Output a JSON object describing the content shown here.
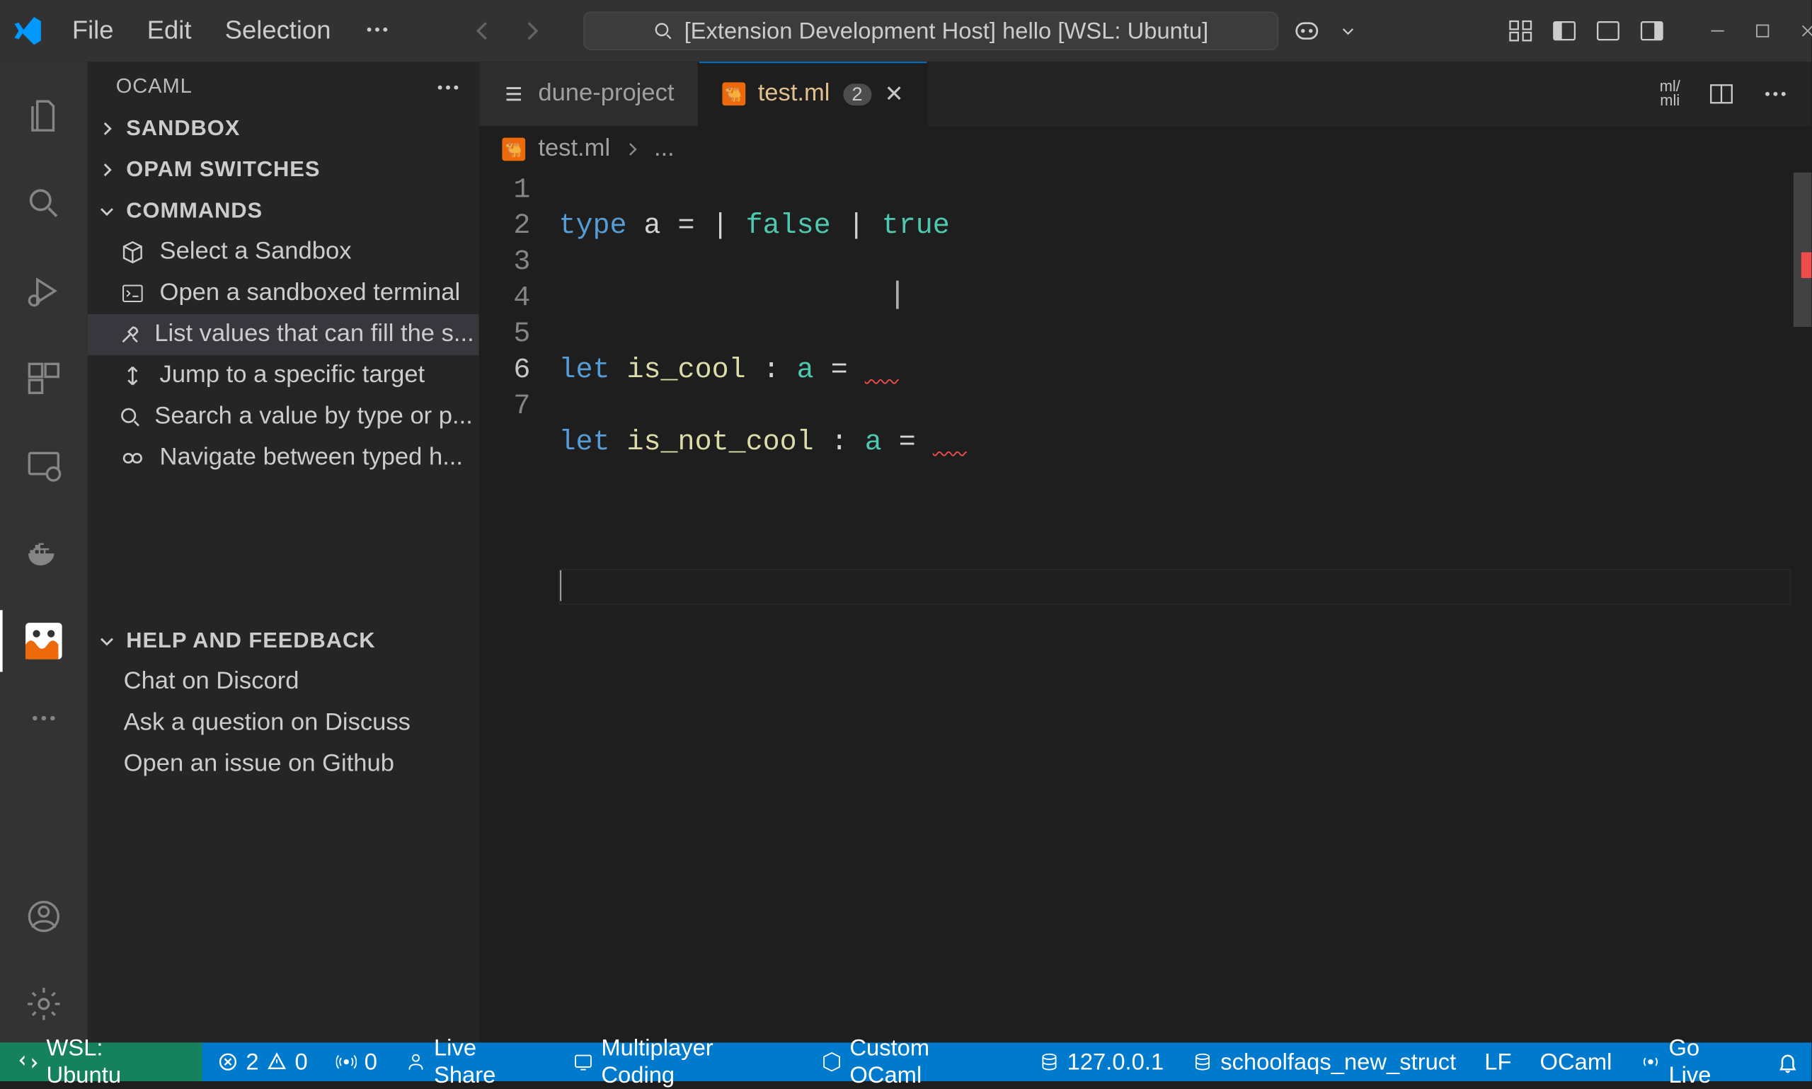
{
  "titlebar": {
    "menu": {
      "file": "File",
      "edit": "Edit",
      "selection": "Selection"
    },
    "search_text": "[Extension Development Host] hello [WSL: Ubuntu]"
  },
  "sidebar": {
    "title": "OCAML",
    "sections": {
      "sandbox": "SANDBOX",
      "opam": "OPAM SWITCHES",
      "commands": "COMMANDS",
      "help": "HELP AND FEEDBACK"
    },
    "commands": [
      "Select a Sandbox",
      "Open a sandboxed terminal",
      "List values that can fill the s...",
      "Jump to a specific target",
      "Search a value by type or p...",
      "Navigate between typed h..."
    ],
    "help_items": [
      "Chat on Discord",
      "Ask a question on Discuss",
      "Open an issue on Github"
    ]
  },
  "tabs": {
    "t1": {
      "label": "dune-project"
    },
    "t2": {
      "label": "test.ml",
      "badge": "2"
    }
  },
  "breadcrumb": {
    "file": "test.ml",
    "rest": "..."
  },
  "code": {
    "lines": [
      "1",
      "2",
      "3",
      "4",
      "5",
      "6",
      "7"
    ],
    "l1": {
      "kw": "type",
      "ident": "a",
      "eq": "=",
      "p1": "|",
      "v1": "false",
      "p2": "|",
      "v2": "true"
    },
    "l3": {
      "kw": "let",
      "name": "is_cool",
      "colon": ":",
      "ty": "a",
      "eq": "="
    },
    "l4": {
      "kw": "let",
      "name": "is_not_cool",
      "colon": ":",
      "ty": "a",
      "eq": "="
    }
  },
  "tabactions": {
    "mlmli": "ml/\nmli"
  },
  "statusbar": {
    "remote": "WSL: Ubuntu",
    "errors": "2",
    "warnings": "0",
    "ports": "0",
    "liveshare": "Live Share",
    "multiplayer": "Multiplayer Coding",
    "custom_ocaml": "Custom OCaml",
    "ip": "127.0.0.1",
    "db": "schoolfaqs_new_struct",
    "eol": "LF",
    "lang": "OCaml",
    "golive": "Go Live"
  }
}
